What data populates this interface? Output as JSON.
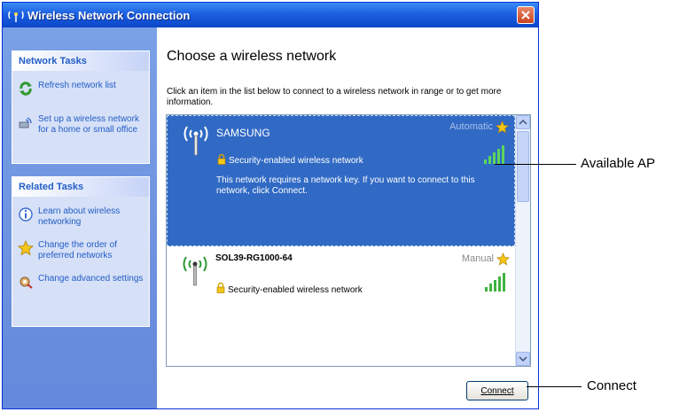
{
  "window": {
    "title": "Wireless Network Connection"
  },
  "left_pane": {
    "network_tasks": {
      "header": "Network Tasks",
      "items": [
        {
          "label": "Refresh network list",
          "icon": "refresh-icon"
        },
        {
          "label": "Set up a wireless network for a home or small office",
          "icon": "setup-network-icon"
        }
      ]
    },
    "related_tasks": {
      "header": "Related Tasks",
      "items": [
        {
          "label": "Learn about wireless networking",
          "icon": "info-icon"
        },
        {
          "label": "Change the order of preferred networks",
          "icon": "star-icon"
        },
        {
          "label": "Change advanced settings",
          "icon": "settings-icon"
        }
      ]
    }
  },
  "main": {
    "title": "Choose a wireless network",
    "instruction": "Click an item in the list below to connect to a wireless network in range or to get more information.",
    "networks": [
      {
        "ssid": "SAMSUNG",
        "mode": "Automatic",
        "security": "Security-enabled wireless network",
        "description": "This network requires a network key. If you want to connect to this network, click Connect.",
        "selected": true
      },
      {
        "ssid": "SOL39-RG1000-64",
        "mode": "Manual",
        "security": "Security-enabled wireless network",
        "selected": false
      }
    ],
    "connect_button": "Connect"
  },
  "annotations": {
    "available_ap": "Available AP",
    "connect": "Connect"
  },
  "colors": {
    "selection": "#316ac5",
    "titlebar": "#0a47c9",
    "left_pane": "#6f94dd",
    "link": "#215dc6"
  }
}
